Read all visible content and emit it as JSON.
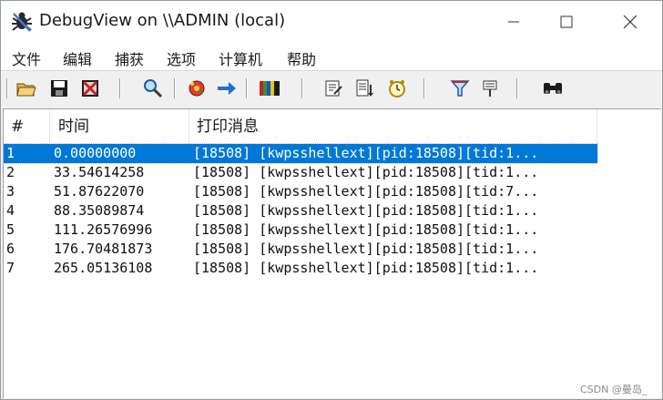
{
  "window": {
    "title": "DebugView on \\\\ADMIN (local)"
  },
  "menu": [
    "文件",
    "编辑",
    "捕获",
    "选项",
    "计算机",
    "帮助"
  ],
  "toolbar_icons": [
    "open-folder-icon",
    "save-disk-icon",
    "clear-display-icon",
    "find-magnifier-icon",
    "capture-gear-icon",
    "autoscroll-arrow-icon",
    "filter-highlight-icon",
    "history-depth-icon",
    "append-log-icon",
    "clock-icon",
    "highlight-funnel-icon",
    "filter-pin-icon",
    "binoculars-icon"
  ],
  "columns": {
    "num": "#",
    "time": "时间",
    "message": "打印消息"
  },
  "rows": [
    {
      "num": "1",
      "time": "0.00000000",
      "message": "[18508] [kwpsshellext][pid:18508][tid:1...",
      "selected": true
    },
    {
      "num": "2",
      "time": "33.54614258",
      "message": "[18508] [kwpsshellext][pid:18508][tid:1...",
      "selected": false
    },
    {
      "num": "3",
      "time": "51.87622070",
      "message": "[18508] [kwpsshellext][pid:18508][tid:7...",
      "selected": false
    },
    {
      "num": "4",
      "time": "88.35089874",
      "message": "[18508] [kwpsshellext][pid:18508][tid:1...",
      "selected": false
    },
    {
      "num": "5",
      "time": "111.26576996",
      "message": "[18508] [kwpsshellext][pid:18508][tid:1...",
      "selected": false
    },
    {
      "num": "6",
      "time": "176.70481873",
      "message": "[18508] [kwpsshellext][pid:18508][tid:1...",
      "selected": false
    },
    {
      "num": "7",
      "time": "265.05136108",
      "message": "[18508] [kwpsshellext][pid:18508][tid:1...",
      "selected": false
    }
  ],
  "watermark": "CSDN @曼岛_",
  "colors": {
    "selection": "#0078d7",
    "window_bg": "#f0f0f0"
  }
}
